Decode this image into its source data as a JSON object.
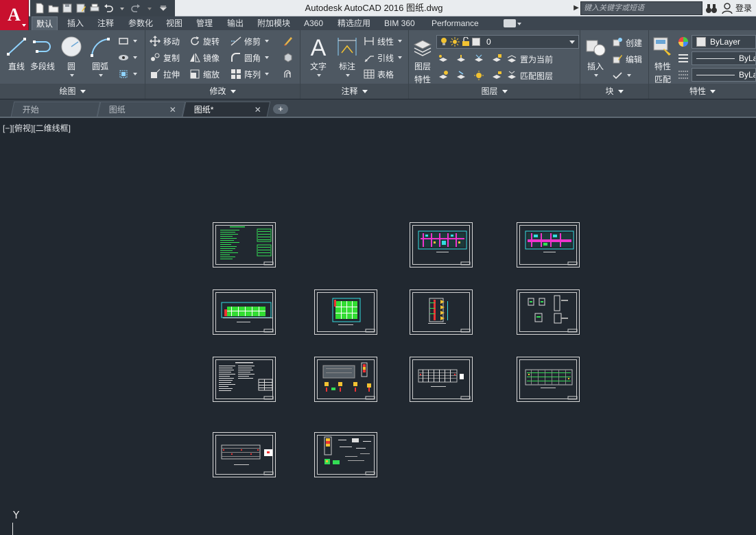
{
  "app": {
    "window_title": "Autodesk AutoCAD 2016    图纸.dwg",
    "search_placeholder": "键入关键字或短语",
    "login_label": "登录",
    "logo_letter": "A"
  },
  "ribbon_tabs": [
    {
      "label": "默认",
      "active": true
    },
    {
      "label": "插入"
    },
    {
      "label": "注释"
    },
    {
      "label": "参数化"
    },
    {
      "label": "视图"
    },
    {
      "label": "管理"
    },
    {
      "label": "输出"
    },
    {
      "label": "附加模块"
    },
    {
      "label": "A360"
    },
    {
      "label": "精选应用"
    },
    {
      "label": "BIM 360"
    },
    {
      "label": "Performance"
    }
  ],
  "panels": {
    "draw": {
      "title": "绘图",
      "tools": {
        "line": "直线",
        "polyline": "多段线",
        "circle": "圆",
        "arc": "圆弧"
      }
    },
    "modify": {
      "title": "修改",
      "tools": {
        "move": "移动",
        "rotate": "旋转",
        "trim": "修剪",
        "copy": "复制",
        "mirror": "镜像",
        "fillet": "圆角",
        "stretch": "拉伸",
        "scale": "缩放",
        "array": "阵列"
      }
    },
    "annotation": {
      "title": "注释",
      "tools": {
        "text": "文字",
        "dimension": "标注",
        "linear": "线性",
        "leader": "引线",
        "table": "表格"
      }
    },
    "layers": {
      "title": "图层",
      "properties_line1": "图层",
      "properties_line2": "特性",
      "current_layer": "0",
      "set_current": "置为当前",
      "match_layer": "匹配图层"
    },
    "block": {
      "title": "块",
      "insert": "插入",
      "create": "创建",
      "edit": "编辑"
    },
    "properties": {
      "title": "特性",
      "match_line1": "特性",
      "match_line2": "匹配",
      "color_value": "ByLayer",
      "linetype_value": "ByLa",
      "lineweight_value": "ByLa"
    }
  },
  "file_tabs": [
    {
      "label": "开始",
      "closable": false,
      "active": false
    },
    {
      "label": "图纸",
      "closable": true,
      "active": false
    },
    {
      "label": "图纸*",
      "closable": true,
      "active": true
    }
  ],
  "viewport_label": "[−][俯视][二维线框]",
  "ucs_axis_label": "Y",
  "colors": {
    "canvas": "#212830",
    "ribbon": "#4e5862",
    "logo": "#c8102e"
  }
}
